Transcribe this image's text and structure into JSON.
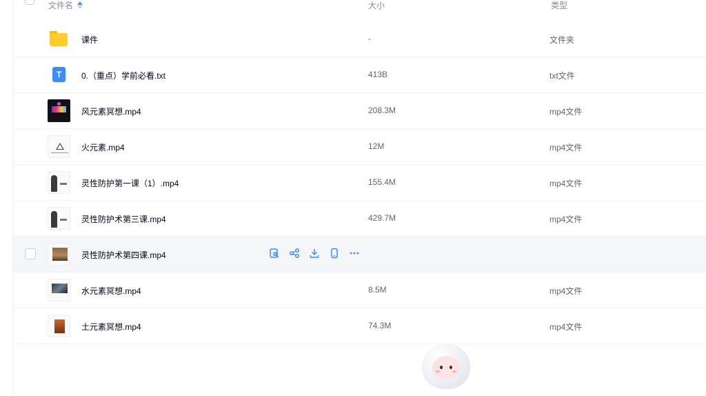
{
  "header": {
    "name_label": "文件名",
    "size_label": "大小",
    "type_label": "类型"
  },
  "files": [
    {
      "name": "课件",
      "size": "-",
      "type": "文件夹",
      "icon": "folder-icon"
    },
    {
      "name": "0.（重点）学前必看.txt",
      "size": "413B",
      "type": "txt文件",
      "icon": "txt-file-icon"
    },
    {
      "name": "风元素冥想.mp4",
      "size": "208.3M",
      "type": "mp4文件",
      "icon": "video-thumbnail"
    },
    {
      "name": "火元素.mp4",
      "size": "12M",
      "type": "mp4文件",
      "icon": "video-thumbnail"
    },
    {
      "name": "灵性防护第一课（1）.mp4",
      "size": "155.4M",
      "type": "mp4文件",
      "icon": "video-thumbnail"
    },
    {
      "name": "灵性防护术第三课.mp4",
      "size": "429.7M",
      "type": "mp4文件",
      "icon": "video-thumbnail"
    },
    {
      "name": "灵性防护术第四课.mp4",
      "size": "",
      "type": "",
      "icon": "video-thumbnail"
    },
    {
      "name": "水元素冥想.mp4",
      "size": "8.5M",
      "type": "mp4文件",
      "icon": "video-thumbnail"
    },
    {
      "name": "土元素冥想.mp4",
      "size": "74.3M",
      "type": "mp4文件",
      "icon": "video-thumbnail"
    }
  ],
  "hover_actions": [
    "save-to-drive-icon",
    "share-icon",
    "download-icon",
    "phone-icon",
    "more-icon"
  ],
  "colors": {
    "accent": "#3d8bff",
    "hover_row": "#f4f6fa",
    "folder": "#ffcb2f"
  }
}
